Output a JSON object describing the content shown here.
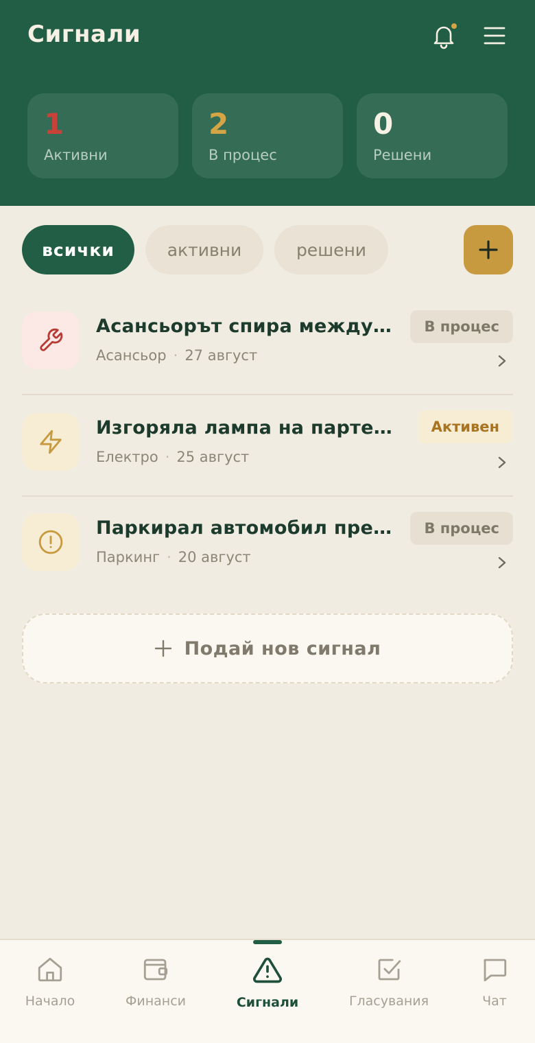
{
  "header": {
    "title": "Сигнали"
  },
  "stats": [
    {
      "value": "1",
      "label": "Активни",
      "color": "#C8423A"
    },
    {
      "value": "2",
      "label": "В процес",
      "color": "#D4A545"
    },
    {
      "value": "0",
      "label": "Решени",
      "color": "#F6F1E4"
    }
  ],
  "filters": [
    {
      "label": "всички",
      "selected": true
    },
    {
      "label": "активни",
      "selected": false
    },
    {
      "label": "решени",
      "selected": false
    }
  ],
  "signals": [
    {
      "title": "Асансьорът спира между етажите",
      "category": "Асансьор",
      "date": "27 август",
      "status": "В процес",
      "icon": "wrench-icon",
      "icon_bg": "#FCE8E5",
      "icon_color": "#B63B36"
    },
    {
      "title": "Изгоряла лампа на партера",
      "category": "Електро",
      "date": "25 август",
      "status": "Активен",
      "icon": "lightning-icon",
      "icon_bg": "#F6EDD4",
      "icon_color": "#C79A40"
    },
    {
      "title": "Паркирал автомобил пред входа",
      "category": "Паркинг",
      "date": "20 август",
      "status": "В процес",
      "icon": "alert-circle-icon",
      "icon_bg": "#F6EDD4",
      "icon_color": "#C79A40"
    }
  ],
  "new_signal_label": "Подай нов сигнал",
  "nav": [
    {
      "label": "Начало",
      "icon": "home-icon"
    },
    {
      "label": "Финанси",
      "icon": "wallet-icon"
    },
    {
      "label": "Сигнали",
      "icon": "warning-icon",
      "current": true
    },
    {
      "label": "Гласувания",
      "icon": "checkbox-icon"
    },
    {
      "label": "Чат",
      "icon": "chat-icon"
    }
  ],
  "colors": {
    "primary": "#215E45",
    "accent": "#C79A40",
    "background": "#F1ECE1"
  }
}
